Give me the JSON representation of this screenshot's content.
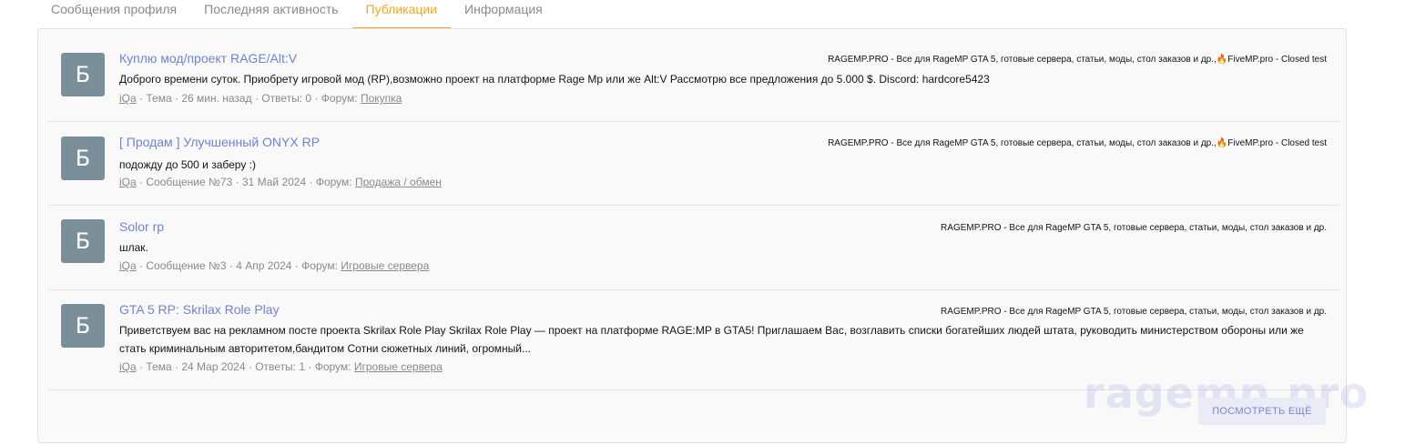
{
  "tabs": [
    {
      "label": "Сообщения профиля",
      "active": false
    },
    {
      "label": "Последняя активность",
      "active": false
    },
    {
      "label": "Публикации",
      "active": true
    },
    {
      "label": "Информация",
      "active": false
    }
  ],
  "avatar_letter": "Б",
  "posts": [
    {
      "title": "Куплю мод/проект RAGE/Alt:V",
      "crumb_site": "RAGEMP.PRO - Все для RageMP GTA 5, готовые сервера, статьи, моды, стол заказов и др.,",
      "crumb_extra": "FiveMP.pro - Closed test",
      "snippet": "Доброго времени суток. Приобрету игровой мод (RP),возможно проект на платформе Rage Mp или же Alt:V Рассмотрю все предложения до 5.000 $. Discord: hardcore5423",
      "author": "iQa",
      "type": "Тема",
      "date": "26 мин. назад",
      "replies": "Ответы: 0",
      "forum_label": "Форум:",
      "forum": "Покупка"
    },
    {
      "title": "[ Продам ] Улучшенный ONYX RP",
      "crumb_site": "RAGEMP.PRO - Все для RageMP GTA 5, готовые сервера, статьи, моды, стол заказов и др.,",
      "crumb_extra": "FiveMP.pro - Closed test",
      "snippet": "подожду до 500 и заберу :)",
      "author": "iQa",
      "type": "Сообщение №73",
      "date": "31 Май 2024",
      "replies": "",
      "forum_label": "Форум:",
      "forum": "Продажа / обмен"
    },
    {
      "title": "Solor rp",
      "crumb_site": "RAGEMP.PRO - Все для RageMP GTA 5, готовые сервера, статьи, моды, стол заказов и др.",
      "crumb_extra": "",
      "snippet": "шлак.",
      "author": "iQa",
      "type": "Сообщение №3",
      "date": "4 Апр 2024",
      "replies": "",
      "forum_label": "Форум:",
      "forum": "Игровые сервера"
    },
    {
      "title": "GTA 5 RP: Skrilax Role Play",
      "crumb_site": "RAGEMP.PRO - Все для RageMP GTA 5, готовые сервера, статьи, моды, стол заказов и др.",
      "crumb_extra": "",
      "snippet": "Приветствуем вас на рекламном посте проекта Skrilax Role Play Skrilax Role Play — проект на платформе RAGE:MP в GTA5! Приглашаем Вас, возглавить списки богатейших людей штата, руководить министерством обороны или же стать криминальным авторитетом,бандитом Сотни сюжетных линий, огромный...",
      "author": "iQa",
      "type": "Тема",
      "date": "24 Мар 2024",
      "replies": "Ответы: 1",
      "forum_label": "Форум:",
      "forum": "Игровые сервера"
    }
  ],
  "more_label": "ПОСМОТРЕТЬ ЕЩЁ",
  "watermark": "ragemp.pro",
  "colors": {
    "accent": "#f5a623",
    "link": "#6f83d8",
    "avatar_bg": "#7b8f9a"
  }
}
